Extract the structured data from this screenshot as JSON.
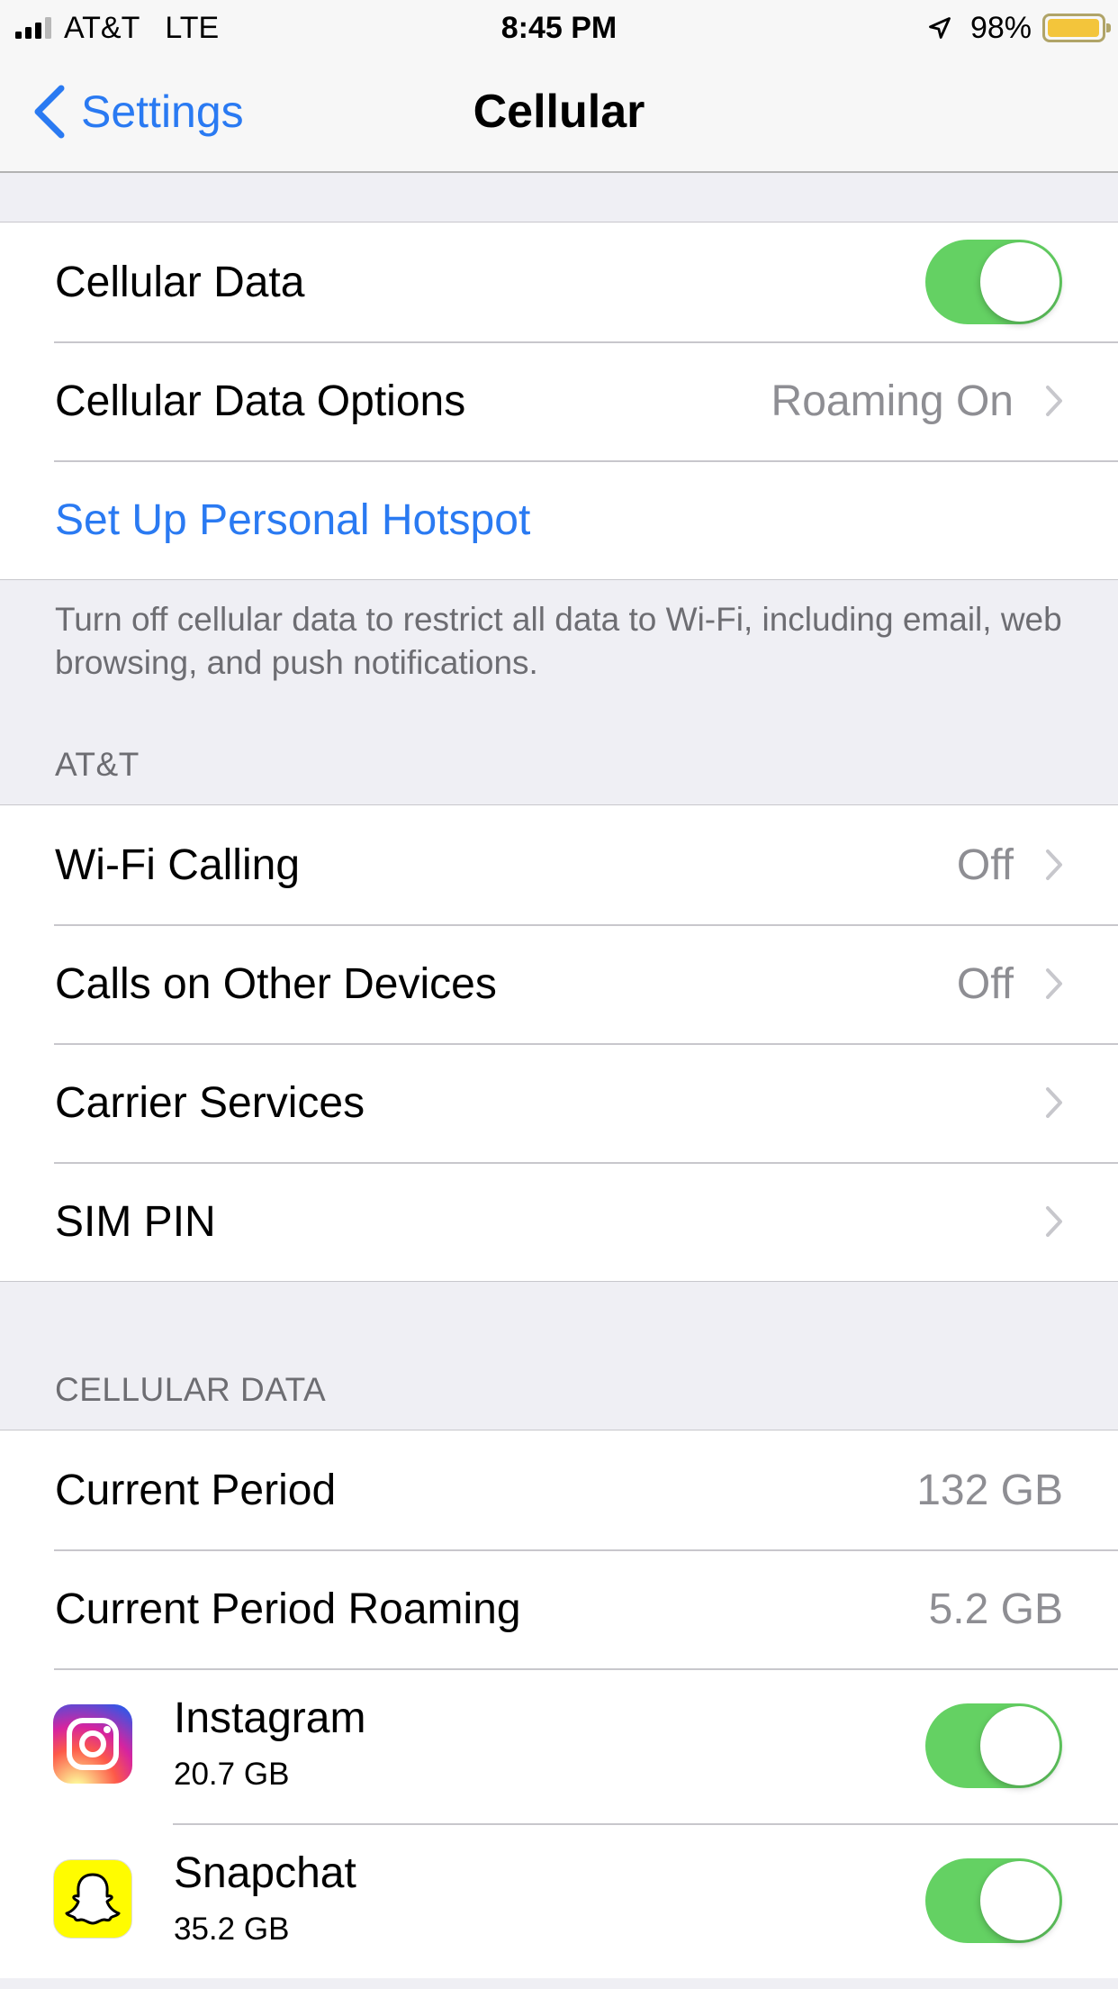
{
  "status_bar": {
    "carrier": "AT&T",
    "network": "LTE",
    "time": "8:45 PM",
    "battery_percent": "98%",
    "battery_level": 0.98,
    "signal_bars": 3
  },
  "nav": {
    "back_label": "Settings",
    "title": "Cellular"
  },
  "group1": {
    "cellular_data_label": "Cellular Data",
    "cellular_data_on": true,
    "options_label": "Cellular Data Options",
    "options_value": "Roaming On",
    "hotspot_label": "Set Up Personal Hotspot",
    "footer": "Turn off cellular data to restrict all data to Wi-Fi, including email, web browsing, and push notifications."
  },
  "carrier_section": {
    "header": "AT&T",
    "wifi_calling_label": "Wi-Fi Calling",
    "wifi_calling_value": "Off",
    "other_devices_label": "Calls on Other Devices",
    "other_devices_value": "Off",
    "carrier_services_label": "Carrier Services",
    "sim_pin_label": "SIM PIN"
  },
  "data_section": {
    "header": "CELLULAR DATA",
    "current_period_label": "Current Period",
    "current_period_value": "132 GB",
    "roaming_label": "Current Period Roaming",
    "roaming_value": "5.2 GB",
    "apps": [
      {
        "name": "Instagram",
        "usage": "20.7 GB",
        "enabled": true,
        "icon": "instagram-icon"
      },
      {
        "name": "Snapchat",
        "usage": "35.2 GB",
        "enabled": true,
        "icon": "snapchat-icon"
      }
    ]
  },
  "colors": {
    "accent": "#2a7af2",
    "toggle_on": "#64d163",
    "background": "#efeff4",
    "secondary_text": "#8e8e93"
  }
}
